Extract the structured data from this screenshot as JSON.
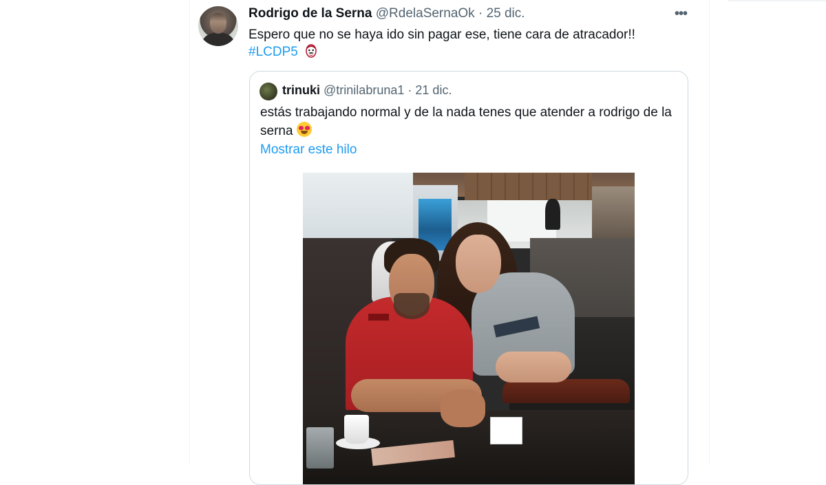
{
  "tweet": {
    "author_name": "Rodrigo de la Serna",
    "author_handle": "@RdelaSernaOk",
    "separator": "·",
    "date": "25 dic.",
    "more_icon": "more-horizontal-icon",
    "more_glyph": "•••",
    "text": "Espero que no se haya ido sin pagar ese, tiene cara de atracador!!",
    "hashtag": "#LCDP5",
    "hashtag_icon": "dali-mask-icon"
  },
  "quoted_tweet": {
    "author_name": "trinuki",
    "author_handle": "@trinilabruna1",
    "separator": "·",
    "date": "21 dic.",
    "text": "estás trabajando normal y de la nada tenes que atender a rodrigo de la serna",
    "emoji": "heart-eyes-emoji",
    "show_thread": "Mostrar este hilo",
    "photo": "cafe-photo"
  },
  "colors": {
    "text_primary": "#0f1419",
    "text_secondary": "#536471",
    "link": "#1d9bf0",
    "border": "#cfd9de"
  }
}
